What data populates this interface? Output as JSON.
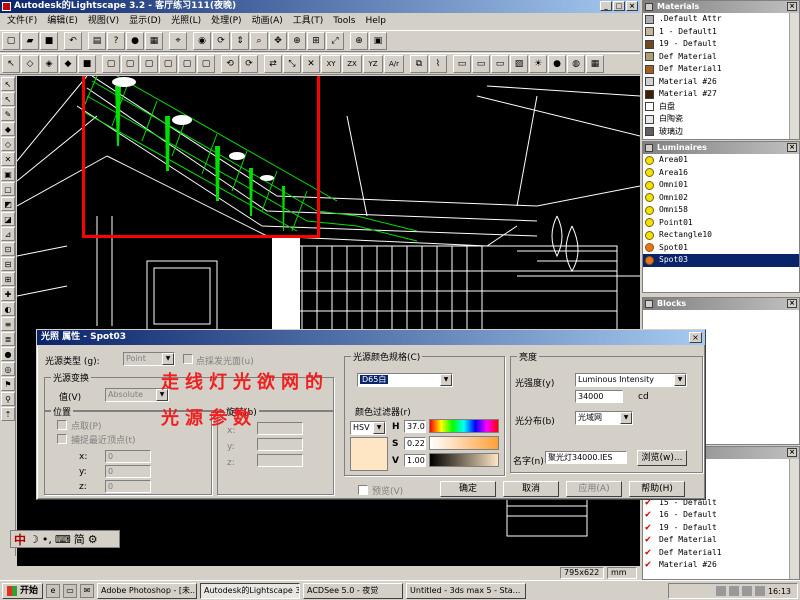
{
  "app": {
    "title": "Autodesk的Lightscape 3.2 - 客厅练习111(夜晚)"
  },
  "menu": [
    "文件(F)",
    "编辑(E)",
    "视图(V)",
    "显示(D)",
    "光照(L)",
    "处理(P)",
    "动画(A)",
    "工具(T)",
    "Tools",
    "Help"
  ],
  "toolbar2_text": [
    "XY",
    "ZX",
    "YZ",
    "A/r"
  ],
  "panels": {
    "materials": {
      "title": "Materials",
      "items": [
        {
          "name": ".Default Attr",
          "color": "#b0b0b0"
        },
        {
          "name": "1 - Default1",
          "color": "#c8b6a0"
        },
        {
          "name": "19 - Default",
          "color": "#704820"
        },
        {
          "name": "Def Material",
          "color": "#b0a070"
        },
        {
          "name": "Def Material1",
          "color": "#a06020"
        },
        {
          "name": "Material #26",
          "color": "#d0d0d0"
        },
        {
          "name": "Material #27",
          "color": "#402000"
        },
        {
          "name": "白盘",
          "color": "#ffffff"
        },
        {
          "name": "白陶瓷",
          "color": "#e8e8e8"
        },
        {
          "name": "玻璃边",
          "color": "#606060"
        }
      ]
    },
    "luminaires": {
      "title": "Luminaires",
      "items": [
        {
          "name": "Area01",
          "type": "bulb"
        },
        {
          "name": "Area16",
          "type": "bulb"
        },
        {
          "name": "Omni01",
          "type": "bulb"
        },
        {
          "name": "Omni02",
          "type": "bulb"
        },
        {
          "name": "Omni58",
          "type": "bulb"
        },
        {
          "name": "Point01",
          "type": "bulb"
        },
        {
          "name": "Rectangle10",
          "type": "bulb"
        },
        {
          "name": "Spot01",
          "type": "spot"
        },
        {
          "name": "Spot03",
          "type": "spot",
          "selected": true
        }
      ]
    },
    "blocks": {
      "title": "Blocks"
    },
    "layers": {
      "items": [
        "l1",
        "l1",
        "tSA",
        "15 - Default",
        "16 - Default",
        "19 - Default",
        "Def Material",
        "Def Material1",
        "Material #26"
      ]
    }
  },
  "dialog": {
    "title": "光照 属性 - Spot03",
    "source_type_label": "光源类型 (g):",
    "source_type_value": "Point",
    "point_emit_label": "点採发光面(u)",
    "transform_group": "光源变换",
    "value_label": "值(V)",
    "value_value": "Absolute",
    "position_group": "位置",
    "point_fetch_label": "点取(P)",
    "snap_label": "捕捉最近顶点(t)",
    "rotate_group": "旋转(b)",
    "x_label": "x:",
    "y_label": "y:",
    "z_label": "z:",
    "coord_zero": "0",
    "preview_label": "预览(V)",
    "color_group": "光源颜色规格(C)",
    "color_value": "D65白",
    "color_filter_label": "颜色过滤器(r)",
    "color_model": "HSV",
    "h_label": "H",
    "h_value": "37.0",
    "s_label": "S",
    "s_value": "0.22",
    "v_label": "V",
    "v_value": "1.00",
    "intensity_group": "亮度",
    "intensity_label": "光强度(y)",
    "intensity_type": "Luminous Intensity",
    "intensity_value": "34000",
    "intensity_unit": "cd",
    "distribution_label": "光分布(b)",
    "distribution_value": "光域网",
    "name_label": "名字(n)",
    "name_value": "聚光灯34000.IES",
    "browse_label": "浏览(w)...",
    "ok_label": "确定",
    "cancel_label": "取消",
    "apply_label": "应用(A)",
    "help_label": "帮助(H)"
  },
  "annotation": {
    "line1": "走线灯光欲网的",
    "line2": "光源参数",
    "color": "#f02020"
  },
  "status": {
    "size": "795x622",
    "unit": "mm"
  },
  "ime": {
    "lang": "中",
    "mode": "简"
  },
  "taskbar": {
    "start_label": "开始",
    "tasks": [
      {
        "label": "Adobe Photoshop - [未...",
        "active": false
      },
      {
        "label": "Autodesk的Lightscape 3....",
        "active": true
      },
      {
        "label": "ACDSee 5.0 - 夜觉",
        "active": false
      },
      {
        "label": "Untitled - 3ds max 5 - Sta...",
        "active": false
      }
    ],
    "clock": "16:13"
  }
}
